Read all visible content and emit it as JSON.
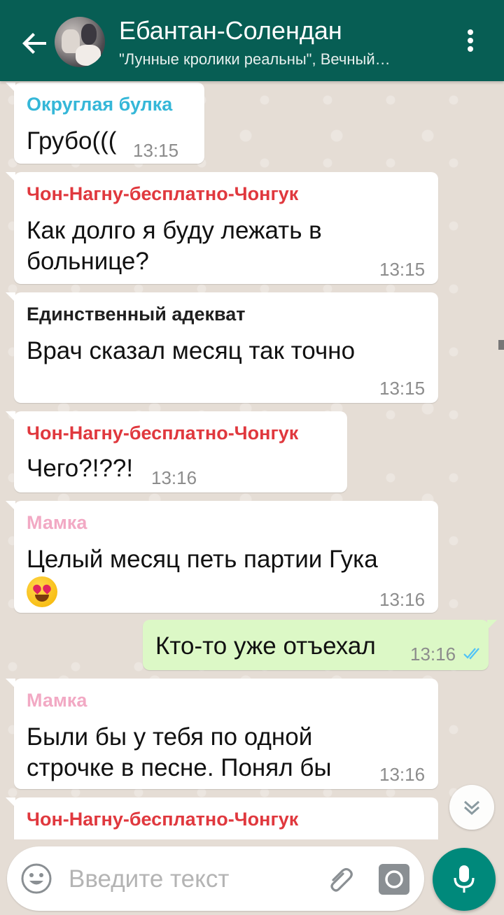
{
  "header": {
    "title": "Ебантан-Солендан",
    "subtitle": "\"Лунные кролики реальны\", Вечный…"
  },
  "colors": {
    "header_bg": "#075e54",
    "incoming_bubble": "#ffffff",
    "outgoing_bubble": "#dcf8c6",
    "mic_button": "#00897b",
    "read_ticks": "#4fc3f7"
  },
  "messages": [
    {
      "direction": "in",
      "sender": "Округлая булка",
      "sender_color": "#35b7d8",
      "text": "Грубо(((",
      "time": "13:15"
    },
    {
      "direction": "in",
      "sender": "Чон-Нагну-бесплатно-Чонгук",
      "sender_color": "#e0383e",
      "text_lines": [
        "Как долго я буду лежать в",
        "больнице?"
      ],
      "time": "13:15"
    },
    {
      "direction": "in",
      "sender": "Единственный адекват",
      "sender_color": "#1f1f1f",
      "text": "Врач сказал месяц так точно",
      "time": "13:15"
    },
    {
      "direction": "in",
      "sender": "Чон-Нагну-бесплатно-Чонгук",
      "sender_color": "#e0383e",
      "text": "Чего?!??!",
      "time": "13:16"
    },
    {
      "direction": "in",
      "sender": "Мамка",
      "sender_color": "#f2a9c4",
      "text": "Целый месяц петь партии Гука",
      "emoji": "heart-eyes-emoji",
      "time": "13:16"
    },
    {
      "direction": "out",
      "text": "Кто-то уже отъехал",
      "time": "13:16",
      "status": "read"
    },
    {
      "direction": "in",
      "sender": "Мамка",
      "sender_color": "#f2a9c4",
      "text_lines": [
        "Были бы у тебя по одной",
        "строчке в песне. Понял бы"
      ],
      "time": "13:16"
    },
    {
      "direction": "in",
      "sender": "Чон-Нагну-бесплатно-Чонгук",
      "sender_color": "#e0383e"
    }
  ],
  "composer": {
    "placeholder": "Введите текст"
  },
  "icons": [
    "back-arrow-icon",
    "more-vert-icon",
    "emoji-icon",
    "attach-icon",
    "camera-icon",
    "mic-icon",
    "chevron-down-icon",
    "double-check-icon"
  ]
}
